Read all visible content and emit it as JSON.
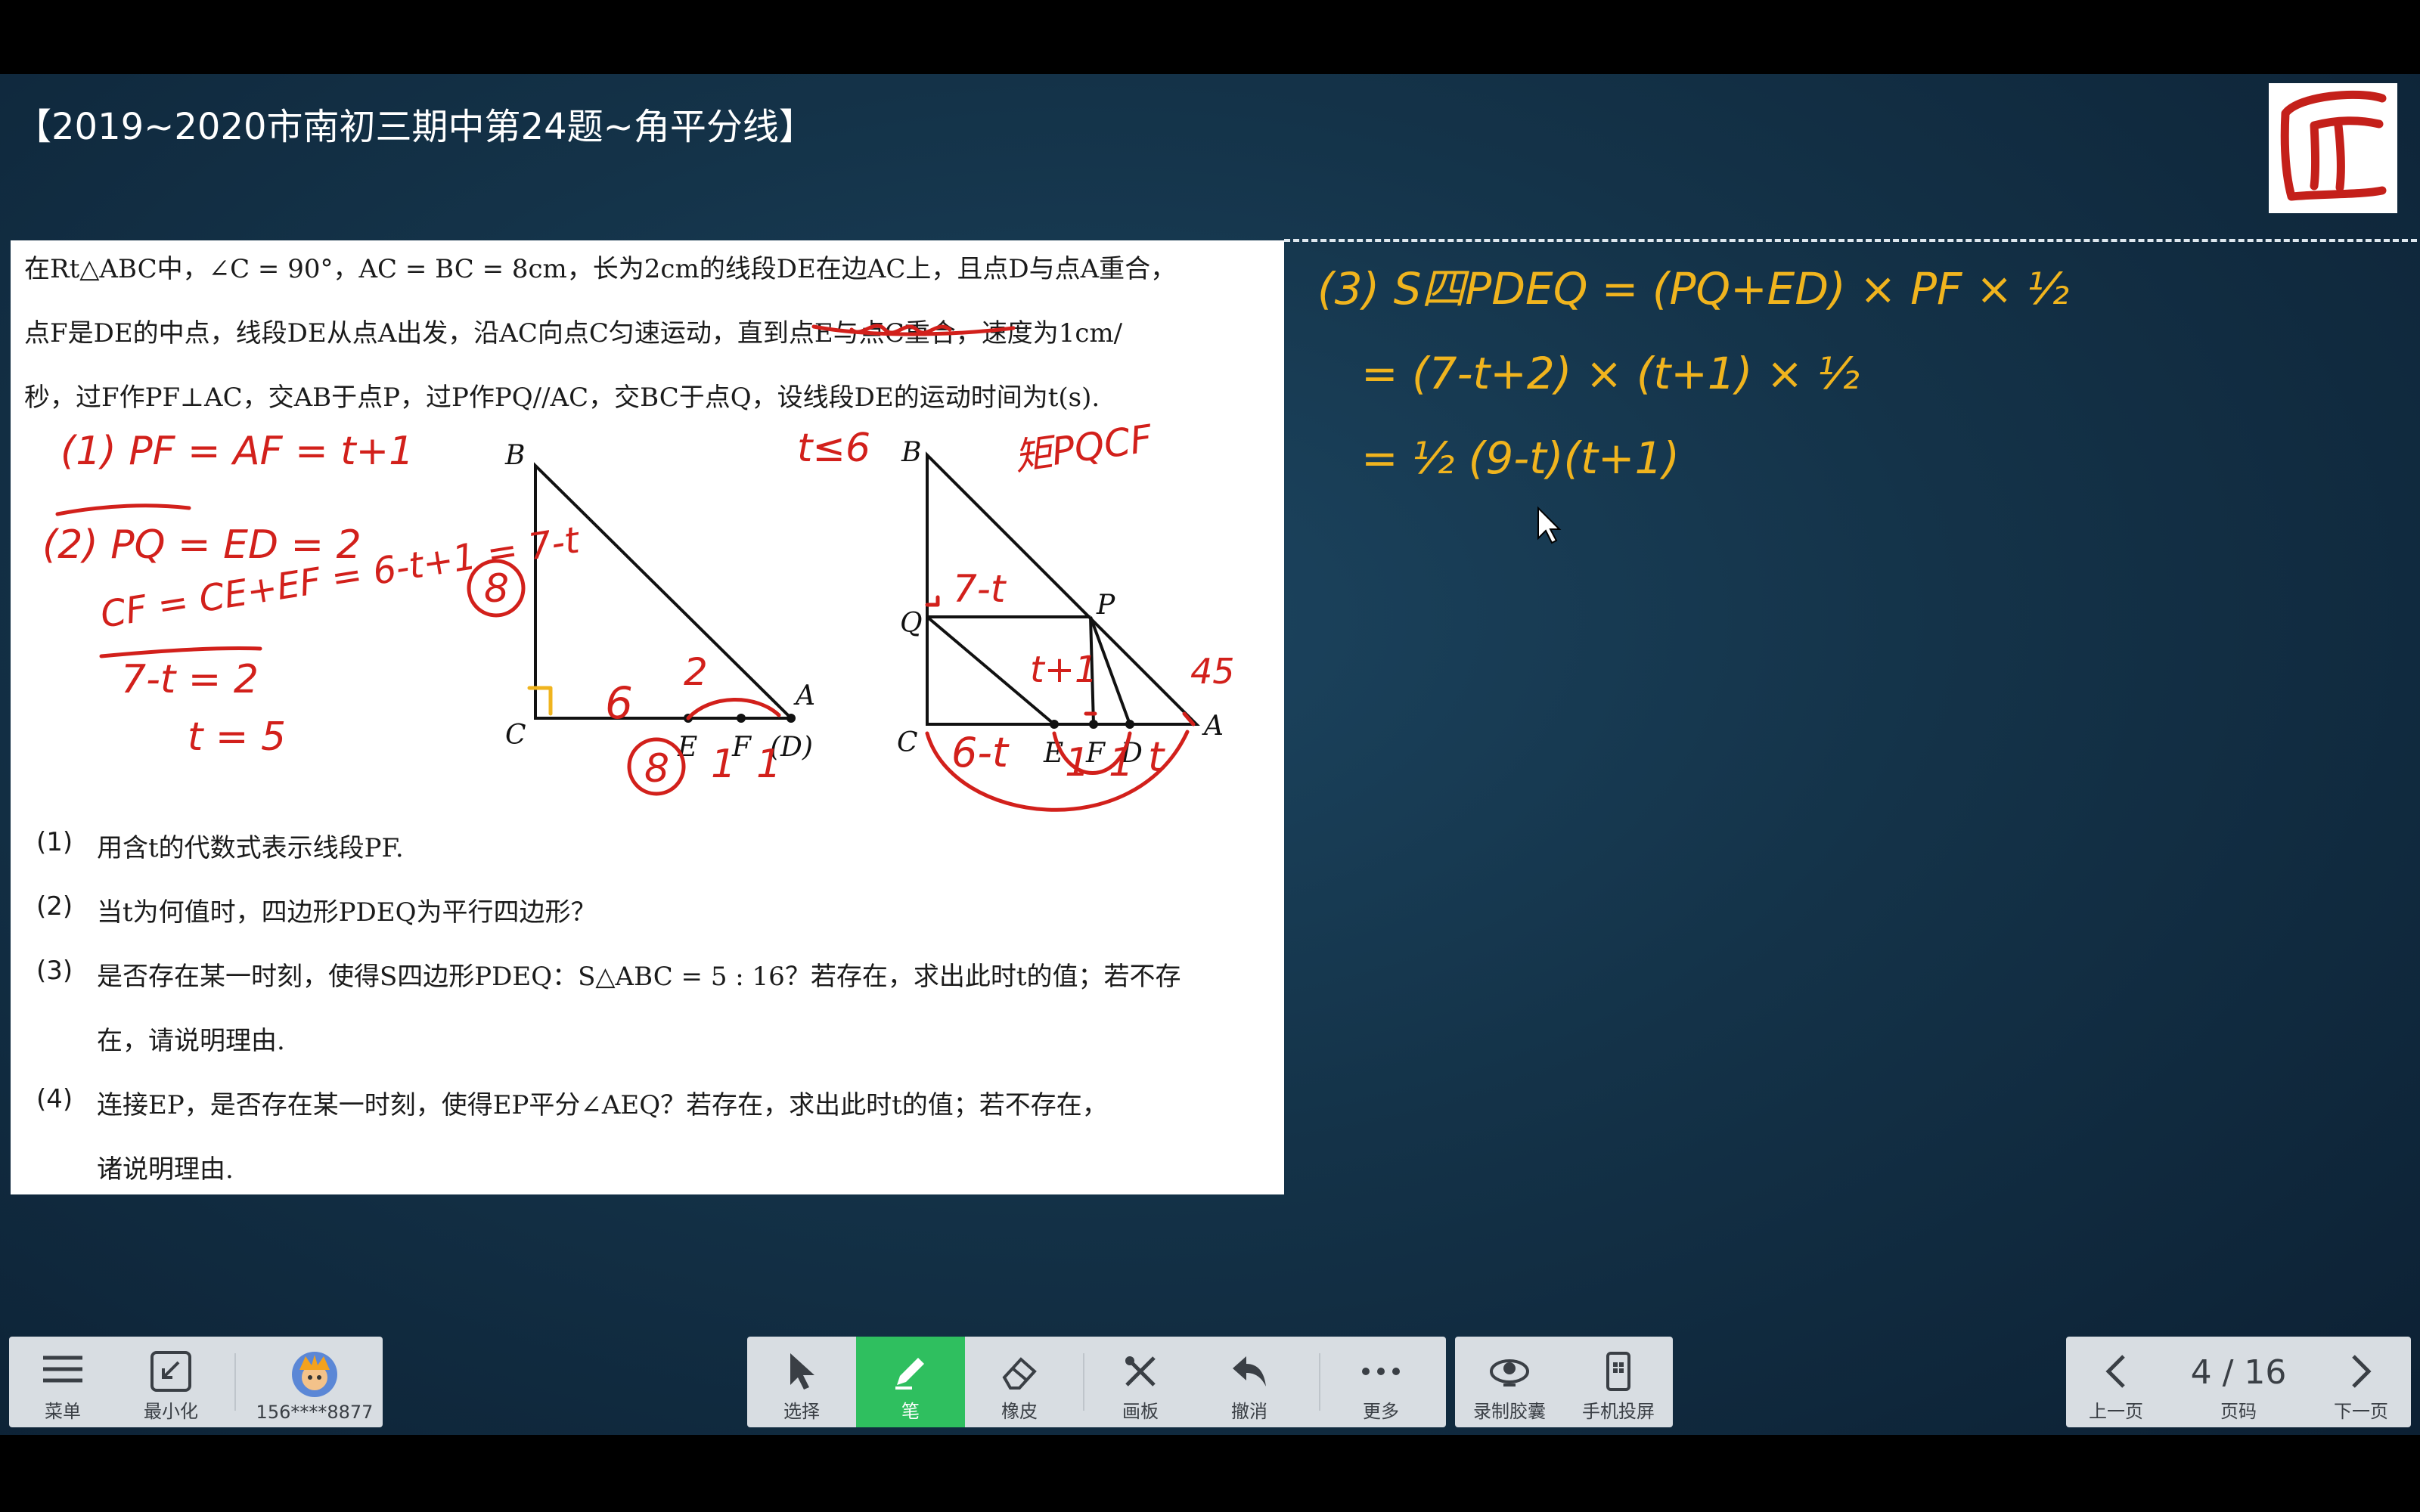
{
  "slide": {
    "title": "【2019~2020市南初三期中第24题~角平分线】"
  },
  "problem": {
    "lines": [
      "在Rt△ABC中，∠C = 90°，AC = BC = 8cm，长为2cm的线段DE在边AC上，且点D与点A重合，",
      "点F是DE的中点，线段DE从点A出发，沿AC向点C匀速运动，直到点E与点C重合，速度为1cm/",
      "秒，过F作PF⊥AC，交AB于点P，过P作PQ//AC，交BC于点Q，设线段DE的运动时间为t(s)."
    ],
    "questions": [
      {
        "num": "(1)",
        "text": "用含t的代数式表示线段PF."
      },
      {
        "num": "(2)",
        "text": "当t为何值时，四边形PDEQ为平行四边形？"
      },
      {
        "num": "(3)",
        "text": "是否存在某一时刻，使得S四边形PDEQ：S△ABC = 5 : 16？若存在，求出此时t的值；若不存"
      },
      {
        "num": "",
        "text": "在，请说明理由."
      },
      {
        "num": "(4)",
        "text": "连接EP，是否存在某一时刻，使得EP平分∠AEQ？若存在，求出此时t的值；若不存在，"
      },
      {
        "num": "",
        "text": "诸说明理由."
      }
    ],
    "figure1_labels": {
      "B": "B",
      "C": "C",
      "A": "A",
      "E": "E",
      "F": "F",
      "D": "(D)"
    },
    "figure2_labels": {
      "B": "B",
      "Q": "Q",
      "P": "P",
      "C": "C",
      "E": "E",
      "F": "F",
      "D": "D",
      "A": "A"
    }
  },
  "annotations": {
    "red": {
      "a1": "(1) PF = AF = t+1",
      "a2a": "(2) PQ = ED = 2",
      "a2b": "CF = CE+EF = 6-t+1 = 7-t",
      "a2c": "7-t = 2",
      "a2d": "t = 5",
      "circle8": "8",
      "six": "6",
      "two": "2",
      "b8": "8",
      "one1": "1",
      "one2": "1",
      "t6": "t≤6",
      "rect": "矩PQCF",
      "s7t": "7-t",
      "st1": "t+1",
      "s45": "45",
      "s6t": "6-t",
      "s1": "1",
      "s1b": "1",
      "st": "t"
    },
    "yellow": {
      "y1": "(3) S四PDEQ = (PQ+ED) × PF × ½",
      "y2": "= (7-t+2) × (t+1) × ½",
      "y3": "= ½ (9-t)(t+1)"
    }
  },
  "toolbar": {
    "left": [
      {
        "label": "菜单",
        "icon": "menu-icon"
      },
      {
        "label": "最小化",
        "icon": "minimize-icon"
      },
      {
        "label": "156****8877",
        "icon": "avatar"
      }
    ],
    "center": [
      {
        "label": "选择",
        "icon": "cursor-icon"
      },
      {
        "label": "笔",
        "icon": "pen-icon",
        "active": true
      },
      {
        "label": "橡皮",
        "icon": "eraser-icon"
      },
      {
        "label": "画板",
        "icon": "drawing-board-icon"
      },
      {
        "label": "撤消",
        "icon": "undo-icon"
      },
      {
        "label": "更多",
        "icon": "more-icon"
      }
    ],
    "extra": [
      {
        "label": "录制胶囊",
        "icon": "record-capsule-icon"
      },
      {
        "label": "手机投屏",
        "icon": "phone-cast-icon"
      }
    ],
    "pager": {
      "prev": "上一页",
      "page_label": "页码",
      "current": "4 / 16",
      "next": "下一页"
    }
  },
  "colors": {
    "active": "#2fbf5f",
    "ink_red": "#d2201b",
    "ink_yellow": "#f0b41e"
  }
}
